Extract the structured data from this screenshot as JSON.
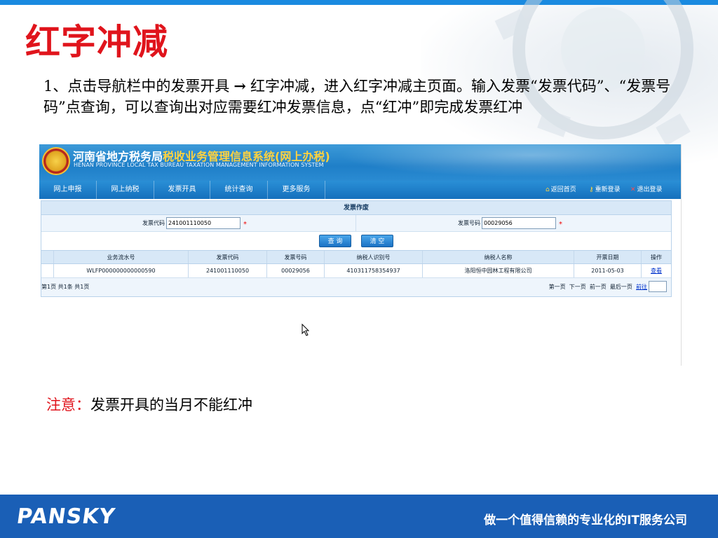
{
  "slide": {
    "title": "红字冲减",
    "desc_part1": "1、点击导航栏中的发票开具",
    "desc_arrow": "→",
    "desc_part2": "红字冲减，进入红字冲减主页面。输入发票“发票代码”、“发票号码”点查询，可以查询出对应需要红冲发票信息，点“红冲”即完成发票红冲",
    "note_label": "注意：",
    "note_text": "发票开具的当月不能红冲"
  },
  "app": {
    "banner_title_a": "河南省地方税务局",
    "banner_title_b": "税收业务管理信息系统(网上办税)",
    "banner_subtitle": "HENAN PROVINCE LOCAL TAX  BUREAU TAXATION MANAGEMENT INFORMATION SYSTEM",
    "nav": [
      "网上申报",
      "网上纳税",
      "发票开具",
      "统计查询",
      "更多服务"
    ],
    "nav_right": {
      "home": "返回首页",
      "relogin": "重新登录",
      "logout": "退出登录"
    },
    "panel_title": "发票作废",
    "query": {
      "code_label": "发票代码",
      "code_value": "241001110050",
      "number_label": "发票号码",
      "number_value": "00029056",
      "required_mark": "*"
    },
    "buttons": {
      "search": "查 询",
      "clear": "清 空"
    },
    "table": {
      "headers": [
        "业务流水号",
        "发票代码",
        "发票号码",
        "纳税人识别号",
        "纳税人名称",
        "开票日期",
        "操作"
      ],
      "row": [
        "WLFP000000000000590",
        "241001110050",
        "00029056",
        "410311758354937",
        "洛阳恒中园林工程有限公司",
        "2011-05-03",
        "查看"
      ]
    },
    "pager": {
      "summary": "第1页  共1条  共1页",
      "first": "第一页",
      "prev": "下一页",
      "next": "前一页",
      "last": "最后一页",
      "go": "前往"
    }
  },
  "footer": {
    "logo": "PANSKY",
    "slogan": "做一个值得信赖的专业化的IT服务公司"
  },
  "colors": {
    "title_red": "#e0141c",
    "footer_blue": "#1a5fb6",
    "banner_blue": "#1f7fc8"
  }
}
